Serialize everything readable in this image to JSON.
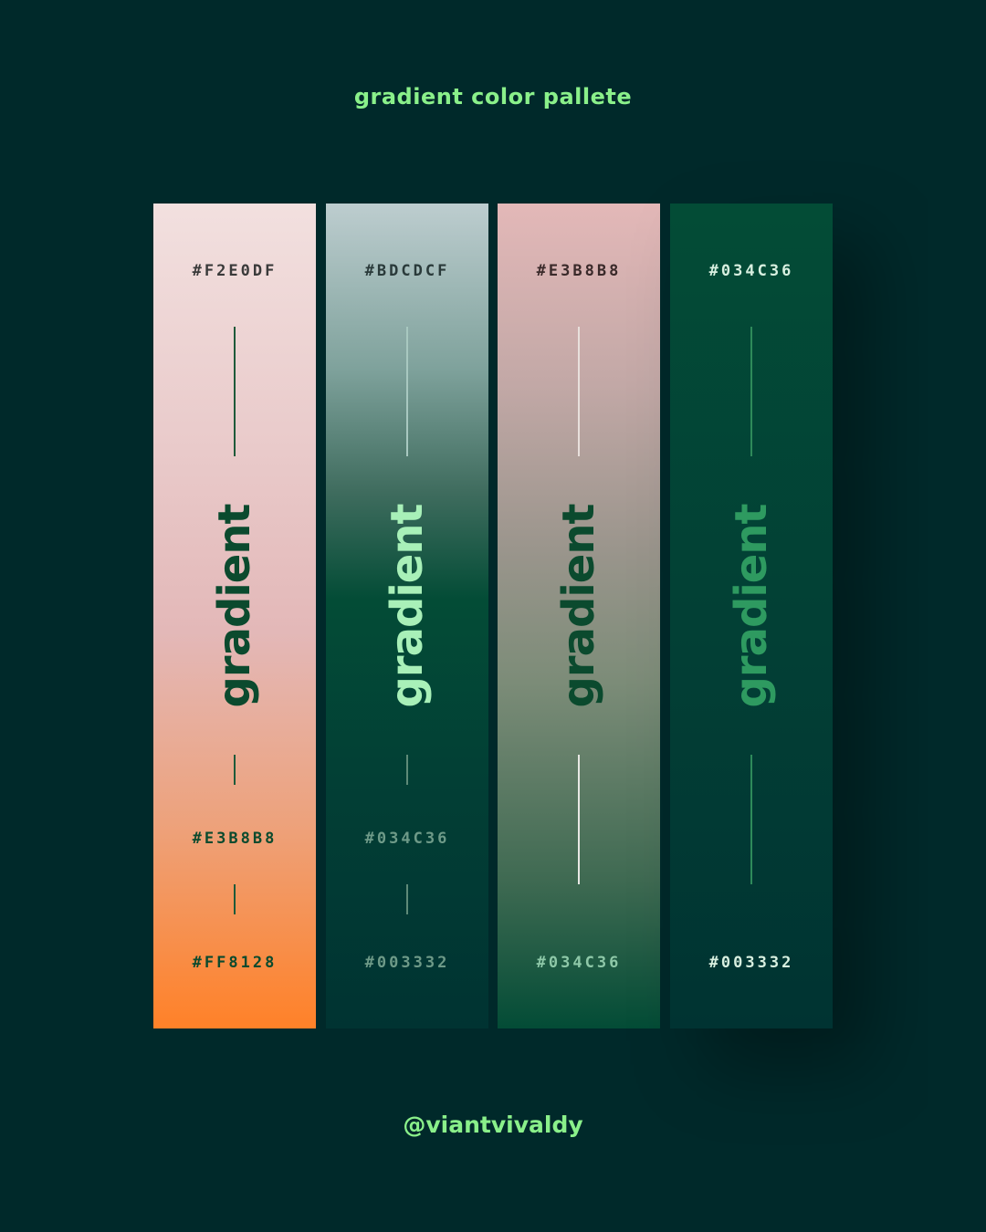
{
  "header": {
    "title": "gradient color pallete"
  },
  "footer": {
    "handle": "@viantvivaldy"
  },
  "palettes": [
    {
      "word": "gradient",
      "hex_top": "#F2E0DF",
      "hex_middle": "#E3B8B8",
      "hex_bottom": "#FF8128",
      "colors": {
        "stops": [
          "#F2E0DF",
          "#E3B8B8",
          "#FF8128"
        ],
        "text": "#0B4A2E",
        "hex_top_text": "#3A3A3A",
        "line": "#1E5A3A"
      }
    },
    {
      "word": "gradient",
      "hex_top": "#BDCDCF",
      "hex_middle": "#034C36",
      "hex_bottom": "#003332",
      "colors": {
        "stops": [
          "#BDCDCF",
          "#034C36",
          "#003332"
        ],
        "text": "#A8F0B8",
        "hex_top_text": "#2A3A3A",
        "line": "#A8C8C0"
      }
    },
    {
      "word": "gradient",
      "hex_top": "#E3B8B8",
      "hex_middle": "",
      "hex_bottom": "#034C36",
      "colors": {
        "stops": [
          "#E3B8B8",
          "#034C36"
        ],
        "text": "#0B4A2E",
        "hex_top_text": "#3A2A2A",
        "line": "#E8E0DC"
      }
    },
    {
      "word": "gradient",
      "hex_top": "#034C36",
      "hex_middle": "",
      "hex_bottom": "#003332",
      "colors": {
        "stops": [
          "#034C36",
          "#003332"
        ],
        "text": "#2E9A60",
        "hex_top_text": "#D8F0E0",
        "line": "#2E8A5A"
      }
    }
  ]
}
